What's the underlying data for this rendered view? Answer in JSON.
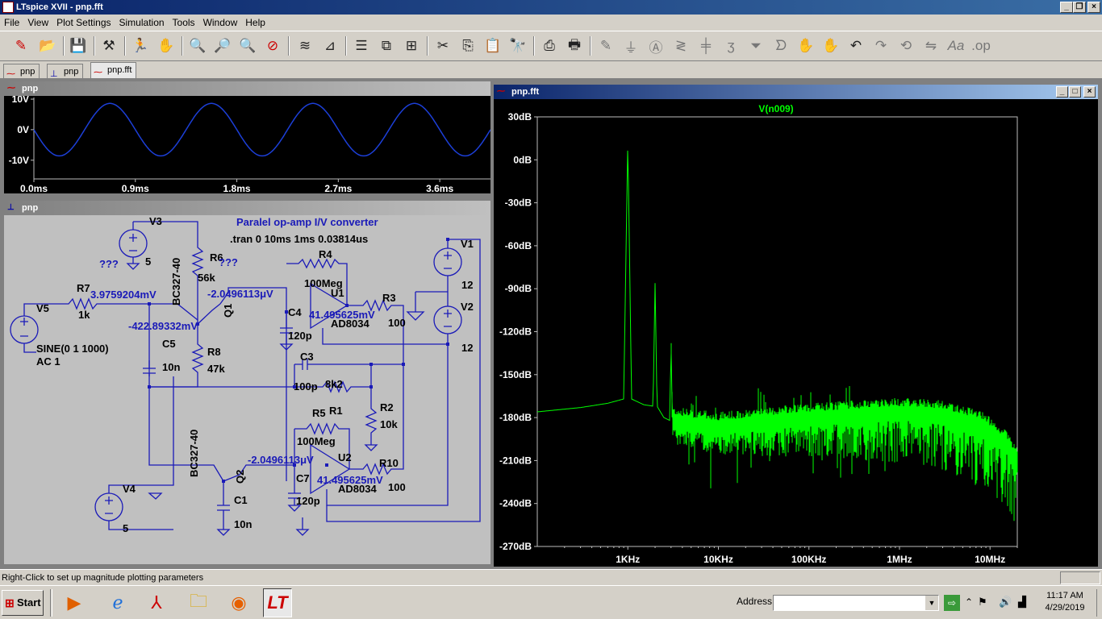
{
  "window": {
    "title": "LTspice XVII - pnp.fft"
  },
  "menu": [
    "File",
    "View",
    "Plot Settings",
    "Simulation",
    "Tools",
    "Window",
    "Help"
  ],
  "toolbar": [
    "new-schematic-icon",
    "open-icon",
    "save-icon",
    "control-panel-icon",
    "run-icon",
    "halt-icon",
    "zoom-in-icon",
    "zoom-area-icon",
    "zoom-out-icon",
    "zoom-fit-icon",
    "autoscale-icon",
    "bode-icon",
    "tile-horizontal-icon",
    "cascade-icon",
    "tile-vertical-icon",
    "cut-icon",
    "copy-icon",
    "paste-icon",
    "find-icon",
    "print-icon",
    "print-preview-icon",
    "wire-icon",
    "ground-icon",
    "label-icon",
    "resistor-icon",
    "capacitor-icon",
    "inductor-icon",
    "diode-icon",
    "component-icon",
    "move-icon",
    "drag-icon",
    "undo-icon",
    "redo-icon",
    "rotate-icon",
    "mirror-icon",
    "text-icon",
    "spice-directive-icon"
  ],
  "tabs": [
    "pnp",
    "pnp",
    "pnp.fft"
  ],
  "wave": {
    "title": "pnp",
    "y_ticks": [
      "10V",
      "0V",
      "-10V"
    ],
    "x_ticks": [
      "0.0ms",
      "0.9ms",
      "1.8ms",
      "2.7ms",
      "3.6ms"
    ]
  },
  "schematic": {
    "title": "pnp",
    "heading": "Paralel op-amp I/V converter",
    "directive": ".tran 0 10ms 1ms 0.03814us",
    "labels": {
      "v3": "V3",
      "v3val": "5",
      "q1model": "BC327-40",
      "r6": "R6",
      "r6val": "56k",
      "unk1": "???",
      "unk2": "???",
      "r7": "R7",
      "r7val": "1k",
      "node1": "3.9759204mV",
      "v5": "V5",
      "v5val": "SINE(0 1 1000)",
      "v5ac": "AC 1",
      "node2": "-422.89332mV",
      "q1": "Q1",
      "node3": "-2.0496113μV",
      "c5": "C5",
      "c5val": "10n",
      "r8": "R8",
      "r8val": "47k",
      "r4": "R4",
      "r4val": "100Meg",
      "u1": "U1",
      "c4": "C4",
      "c4val": "120p",
      "node4": "41.495625mV",
      "u1model": "AD8034",
      "r3": "R3",
      "r3val": "100",
      "v1": "V1",
      "v1val": "12",
      "v2": "V2",
      "v2val": "12",
      "c3": "C3",
      "c3val": "100p",
      "r1": "R1",
      "r1val": "8k2",
      "r2": "R2",
      "r2val": "10k",
      "r5": "R5",
      "r5val": "100Meg",
      "q2model": "BC327-40",
      "q2": "Q2",
      "node5": "-2.0496113μV",
      "u2": "U2",
      "c7": "C7",
      "c7val": "120p",
      "node6": "41.495625mV",
      "u2model": "AD8034",
      "r10": "R10",
      "r10val": "100",
      "v4": "V4",
      "v4val": "5",
      "c1": "C1",
      "c1val": "10n"
    }
  },
  "fft": {
    "title": "pnp.fft",
    "trace": "V(n009)"
  },
  "status": "Right-Click to set up magnitude plotting parameters",
  "taskbar": {
    "start": "Start",
    "address_label": "Address",
    "time": "11:17 AM",
    "date": "4/29/2019"
  },
  "chart_data": [
    {
      "type": "line",
      "title": "",
      "xlabel": "",
      "ylabel": "",
      "series": [
        {
          "name": "",
          "x": [
            0,
            0.225,
            0.45,
            0.675,
            0.9,
            1.125,
            1.35,
            1.575,
            1.8,
            2.025,
            2.25,
            2.475,
            2.7,
            2.925,
            3.15,
            3.375,
            3.6,
            3.825,
            4.05
          ],
          "values": [
            0,
            -8.6,
            0,
            8.6,
            0,
            -8.6,
            0,
            8.6,
            0,
            -8.6,
            0,
            8.6,
            0,
            -8.6,
            0,
            8.6,
            0,
            -8.6,
            0
          ]
        }
      ],
      "x_unit": "ms",
      "xlim": [
        0,
        4.05
      ],
      "ylim": [
        -10,
        10
      ],
      "y_ticks": [
        10,
        0,
        -10
      ],
      "x_ticks": [
        0,
        0.9,
        1.8,
        2.7,
        3.6
      ],
      "grid": false
    },
    {
      "type": "line",
      "title": "",
      "xlabel": "",
      "ylabel": "",
      "x_scale": "log",
      "xlim": [
        100,
        20000000
      ],
      "ylim": [
        -270,
        30
      ],
      "y_ticks": [
        30,
        0,
        -30,
        -60,
        -90,
        -120,
        -150,
        -180,
        -210,
        -240,
        -270
      ],
      "x_ticks": [
        "1KHz",
        "10KHz",
        "100KHz",
        "1MHz",
        "10MHz"
      ],
      "background": "#000000",
      "trace_color": "#00ff00",
      "series": [
        {
          "name": "V(n009)",
          "x": [
            100,
            300,
            600,
            900,
            1000,
            1100,
            1500,
            1900,
            2000,
            2100,
            2500,
            2900,
            3000,
            3100,
            5000,
            10000,
            30000,
            100000,
            300000,
            1000000,
            3000000,
            8000000,
            15000000,
            20000000
          ],
          "values": [
            -176,
            -173,
            -170,
            -167,
            15,
            -167,
            -171,
            -172,
            -85,
            -172,
            -180,
            -182,
            -128,
            -182,
            -184,
            -186,
            -183,
            -180,
            -178,
            -176,
            -178,
            -185,
            -198,
            -210
          ]
        }
      ]
    }
  ]
}
